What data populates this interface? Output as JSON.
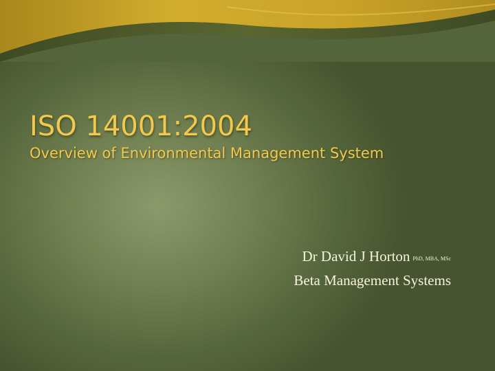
{
  "slide": {
    "title": "ISO 14001:2004",
    "subtitle": "Overview of Environmental Management System",
    "author": "Dr David J Horton",
    "credentials": "PhD, MBA, MSc",
    "organization": "Beta Management Systems"
  },
  "colors": {
    "title": "#f2c94c",
    "body_text": "#f6f3df",
    "background": "#4d5c34",
    "swoosh": "#c9a227"
  }
}
